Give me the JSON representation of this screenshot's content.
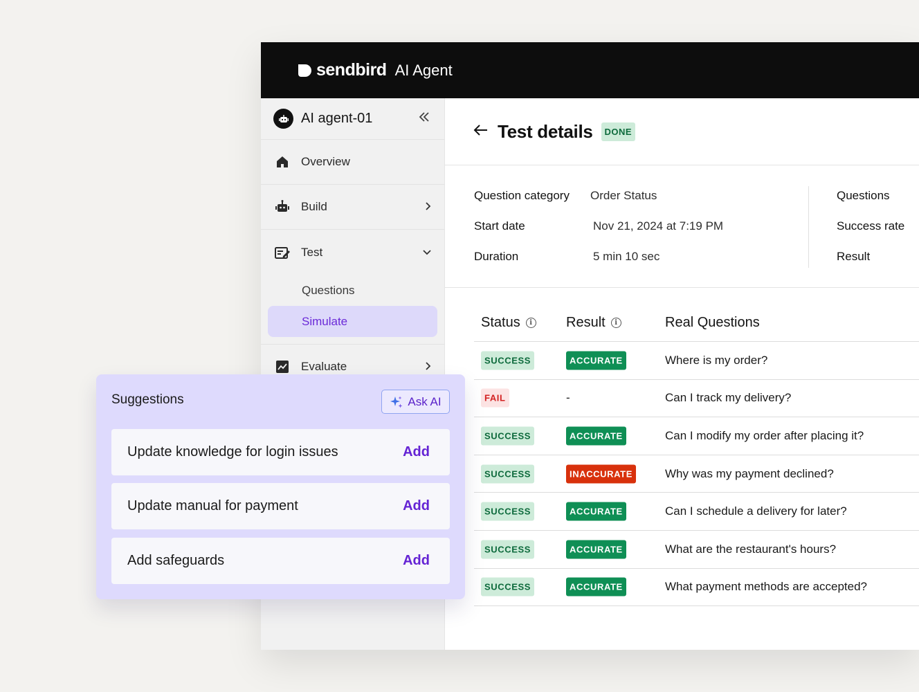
{
  "brand": {
    "name": "sendbird",
    "product": "AI Agent"
  },
  "sidebar": {
    "agent_name": "AI agent-01",
    "items": [
      {
        "label": "Overview"
      },
      {
        "label": "Build"
      },
      {
        "label": "Test"
      },
      {
        "label": "Evaluate"
      }
    ],
    "test_sub": [
      {
        "label": "Questions"
      },
      {
        "label": "Simulate"
      }
    ]
  },
  "header": {
    "title": "Test details",
    "status": "DONE"
  },
  "details": {
    "category_label": "Question category",
    "category_value": "Order Status",
    "start_label": "Start date",
    "start_value": "Nov 21, 2024 at 7:19 PM",
    "duration_label": "Duration",
    "duration_value": "5 min 10 sec",
    "right_labels": [
      "Questions",
      "Success rate",
      "Result"
    ]
  },
  "table": {
    "headers": {
      "status": "Status",
      "result": "Result",
      "question": "Real Questions"
    },
    "rows": [
      {
        "status": "SUCCESS",
        "result": "ACCURATE",
        "question": "Where is my order?"
      },
      {
        "status": "FAIL",
        "result": "-",
        "question": "Can I track my delivery?"
      },
      {
        "status": "SUCCESS",
        "result": "ACCURATE",
        "question": "Can I modify my order after placing it?"
      },
      {
        "status": "SUCCESS",
        "result": "INACCURATE",
        "question": "Why was my payment declined?"
      },
      {
        "status": "SUCCESS",
        "result": "ACCURATE",
        "question": "Can I schedule a delivery for later?"
      },
      {
        "status": "SUCCESS",
        "result": "ACCURATE",
        "question": "What are the restaurant's hours?"
      },
      {
        "status": "SUCCESS",
        "result": "ACCURATE",
        "question": "What payment methods are accepted?"
      }
    ]
  },
  "suggestions": {
    "title": "Suggestions",
    "ask_ai": "Ask AI",
    "items": [
      {
        "text": "Update knowledge for login issues",
        "action": "Add"
      },
      {
        "text": "Update manual for payment",
        "action": "Add"
      },
      {
        "text": "Add safeguards",
        "action": "Add"
      }
    ]
  },
  "colors": {
    "accent": "#6b2ad8",
    "topbar": "#0d0d0d",
    "success_bg": "#cdebd9",
    "accurate_bg": "#0f8f55",
    "inaccurate_bg": "#d8310c",
    "fail_bg": "#fce3e3",
    "suggestions_bg": "#dedafd"
  }
}
